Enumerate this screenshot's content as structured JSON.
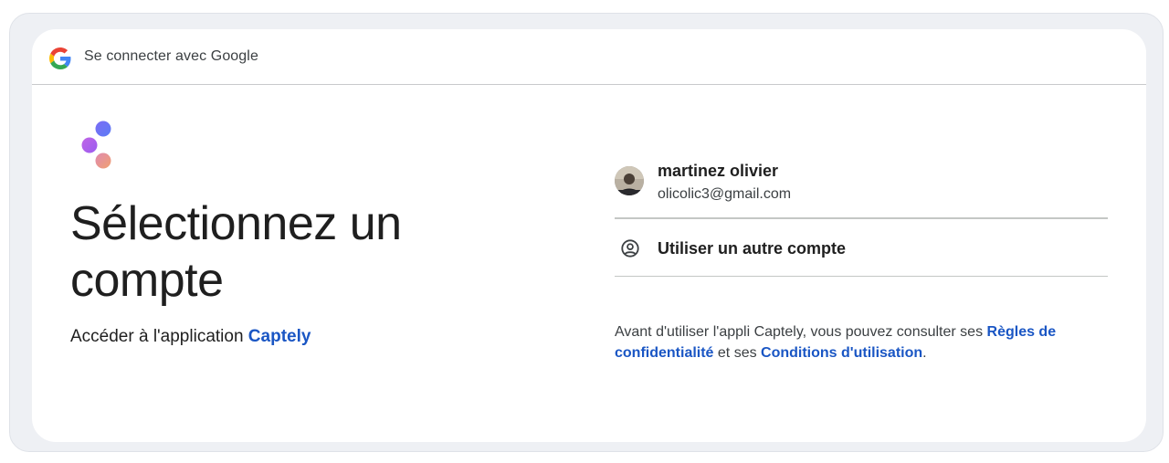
{
  "header": {
    "title": "Se connecter avec Google"
  },
  "main": {
    "title": "Sélectionnez un compte",
    "subtitle_prefix": "Accéder à l'application ",
    "app_name": "Captely"
  },
  "accounts": [
    {
      "name": "martinez olivier",
      "email": "olicolic3@gmail.com"
    }
  ],
  "other_account": {
    "label": "Utiliser un autre compte",
    "icon": "account-circle-icon"
  },
  "legal": {
    "text_before": "Avant d'utiliser l'appli Captely, vous pouvez consulter ses ",
    "privacy_link": "Règles de confidentialité",
    "text_middle": " et ses ",
    "terms_link": "Conditions d'utilisation",
    "text_after": "."
  },
  "colors": {
    "link": "#1a56c4",
    "text": "#1f1f1f",
    "frame": "#eef0f4"
  }
}
